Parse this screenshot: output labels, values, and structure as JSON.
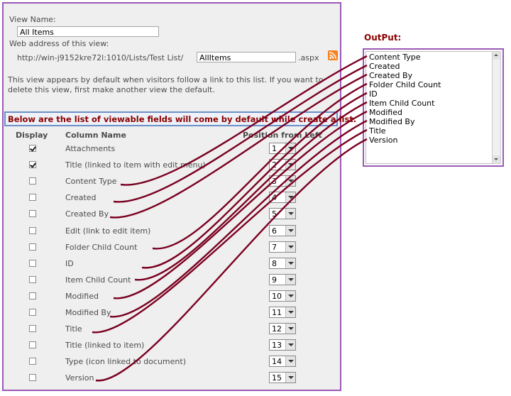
{
  "view": {
    "name_label": "View Name:",
    "name_value": "All Items",
    "web_address_label": "Web address of this view:",
    "url_prefix": "http://win-j9152kre72l:1010/Lists/Test List/",
    "url_value": "AllItems",
    "url_suffix": ".aspx",
    "default_note_line1": "This view appears by default when visitors follow a link to this list. If you want to",
    "default_note_line2": "delete this view, first make another view the default."
  },
  "banner": "Below are the list of viewable fields will come by default while create a list.",
  "table": {
    "headers": {
      "display": "Display",
      "column_name": "Column Name",
      "position": "Position from Left"
    },
    "rows": [
      {
        "name": "Attachments",
        "checked": true,
        "position": "1"
      },
      {
        "name": "Title (linked to item with edit menu)",
        "checked": true,
        "position": "2"
      },
      {
        "name": "Content Type",
        "checked": false,
        "position": "3"
      },
      {
        "name": "Created",
        "checked": false,
        "position": "4"
      },
      {
        "name": "Created By",
        "checked": false,
        "position": "5"
      },
      {
        "name": "Edit (link to edit item)",
        "checked": false,
        "position": "6"
      },
      {
        "name": "Folder Child Count",
        "checked": false,
        "position": "7"
      },
      {
        "name": "ID",
        "checked": false,
        "position": "8"
      },
      {
        "name": "Item Child Count",
        "checked": false,
        "position": "9"
      },
      {
        "name": "Modified",
        "checked": false,
        "position": "10"
      },
      {
        "name": "Modified By",
        "checked": false,
        "position": "11"
      },
      {
        "name": "Title",
        "checked": false,
        "position": "12"
      },
      {
        "name": "Title (linked to item)",
        "checked": false,
        "position": "13"
      },
      {
        "name": "Type (icon linked to document)",
        "checked": false,
        "position": "14"
      },
      {
        "name": "Version",
        "checked": false,
        "position": "15"
      }
    ]
  },
  "output": {
    "label": "OutPut:",
    "items": [
      "Content Type",
      "Created",
      "Created By",
      "Folder Child Count",
      "ID",
      "Item Child Count",
      "Modified",
      "Modified By",
      "Title",
      "Version"
    ]
  },
  "colors": {
    "frame": "#9b59b6",
    "annotation_line": "#7a0020",
    "banner_text": "#8b0000"
  },
  "icons": {
    "rss": "rss-feed-icon"
  }
}
